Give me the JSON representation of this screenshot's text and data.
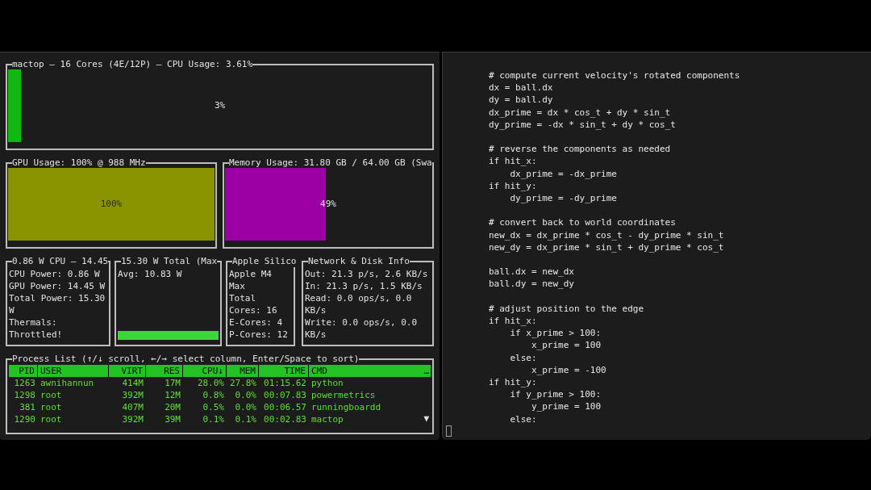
{
  "monitor": {
    "cpu_panel": {
      "title": "mactop – 16 Cores (4E/12P) – CPU Usage: 3.61%",
      "level": 0.03,
      "reading": "3%"
    },
    "gpu_panel": {
      "title": "GPU Usage: 100% @ 988 MHz",
      "level": 1,
      "reading": "100%"
    },
    "memory_panel": {
      "title": "Memory Usage: 31.80 GB / 64.00 GB (Swa",
      "level": 0.49,
      "reading": "49%"
    },
    "info_panels": [
      {
        "kind": "text",
        "title": "0.86 W CPU – 14.45",
        "lines": [
          "CPU Power: 0.86 W",
          "GPU Power: 14.45 W",
          "Total Power: 15.30",
          "W",
          "Thermals:",
          "Throttled!"
        ]
      },
      {
        "kind": "sparkline",
        "title": "15.30 W Total (Max",
        "lines": [
          "Avg: 10.83 W"
        ]
      },
      {
        "kind": "text",
        "title": "Apple Silico",
        "lines": [
          "Apple M4",
          "Max",
          "Total",
          "Cores: 16",
          "E-Cores: 4",
          "P-Cores: 12"
        ]
      },
      {
        "kind": "text",
        "title": "Network & Disk Info",
        "lines": [
          "Out: 21.3 p/s, 2.6 KB/s",
          "In: 21.3 p/s, 1.5 KB/s",
          "Read: 0.0 ops/s, 0.0",
          "KB/s",
          "Write: 0.0 ops/s, 0.0",
          "KB/s"
        ]
      }
    ],
    "process_list": {
      "title": "Process List (↑/↓ scroll, ←/→ select column, Enter/Space to sort)",
      "columns": [
        "PID",
        "USER",
        "VIRT",
        "RES",
        "CPU↓",
        "MEM",
        "TIME",
        "CMD"
      ],
      "overflow_mark": "…",
      "rows": [
        [
          "1263",
          "awnihannun",
          "414M",
          "17M",
          "28.0%",
          "27.8%",
          "01:15.62",
          "python"
        ],
        [
          "1298",
          "root",
          "392M",
          "12M",
          "0.8%",
          "0.0%",
          "00:07.83",
          "powermetrics"
        ],
        [
          "381",
          "root",
          "407M",
          "20M",
          "0.5%",
          "0.0%",
          "00:06.57",
          "runningboardd"
        ],
        [
          "1290",
          "root",
          "392M",
          "39M",
          "0.1%",
          "0.1%",
          "00:02.83",
          "mactop"
        ]
      ],
      "scroll_indicator": "▼"
    }
  },
  "editor": {
    "blocks": [
      [
        "# compute current velocity's rotated components",
        "dx = ball.dx",
        "dy = ball.dy",
        "dx_prime = dx * cos_t + dy * sin_t",
        "dy_prime = -dx * sin_t + dy * cos_t"
      ],
      [
        "# reverse the components as needed",
        "if hit_x:",
        "    dx_prime = -dx_prime",
        "if hit_y:",
        "    dy_prime = -dy_prime"
      ],
      [
        "# convert back to world coordinates",
        "new_dx = dx_prime * cos_t - dy_prime * sin_t",
        "new_dy = dx_prime * sin_t + dy_prime * cos_t"
      ],
      [
        "ball.dx = new_dx",
        "ball.dy = new_dy"
      ],
      [
        "# adjust position to the edge",
        "if hit_x:",
        "    if x_prime > 100:",
        "        x_prime = 100",
        "    else:",
        "        x_prime = -100",
        "if hit_y:",
        "    if y_prime > 100:",
        "        y_prime = 100",
        "    else:"
      ]
    ]
  }
}
